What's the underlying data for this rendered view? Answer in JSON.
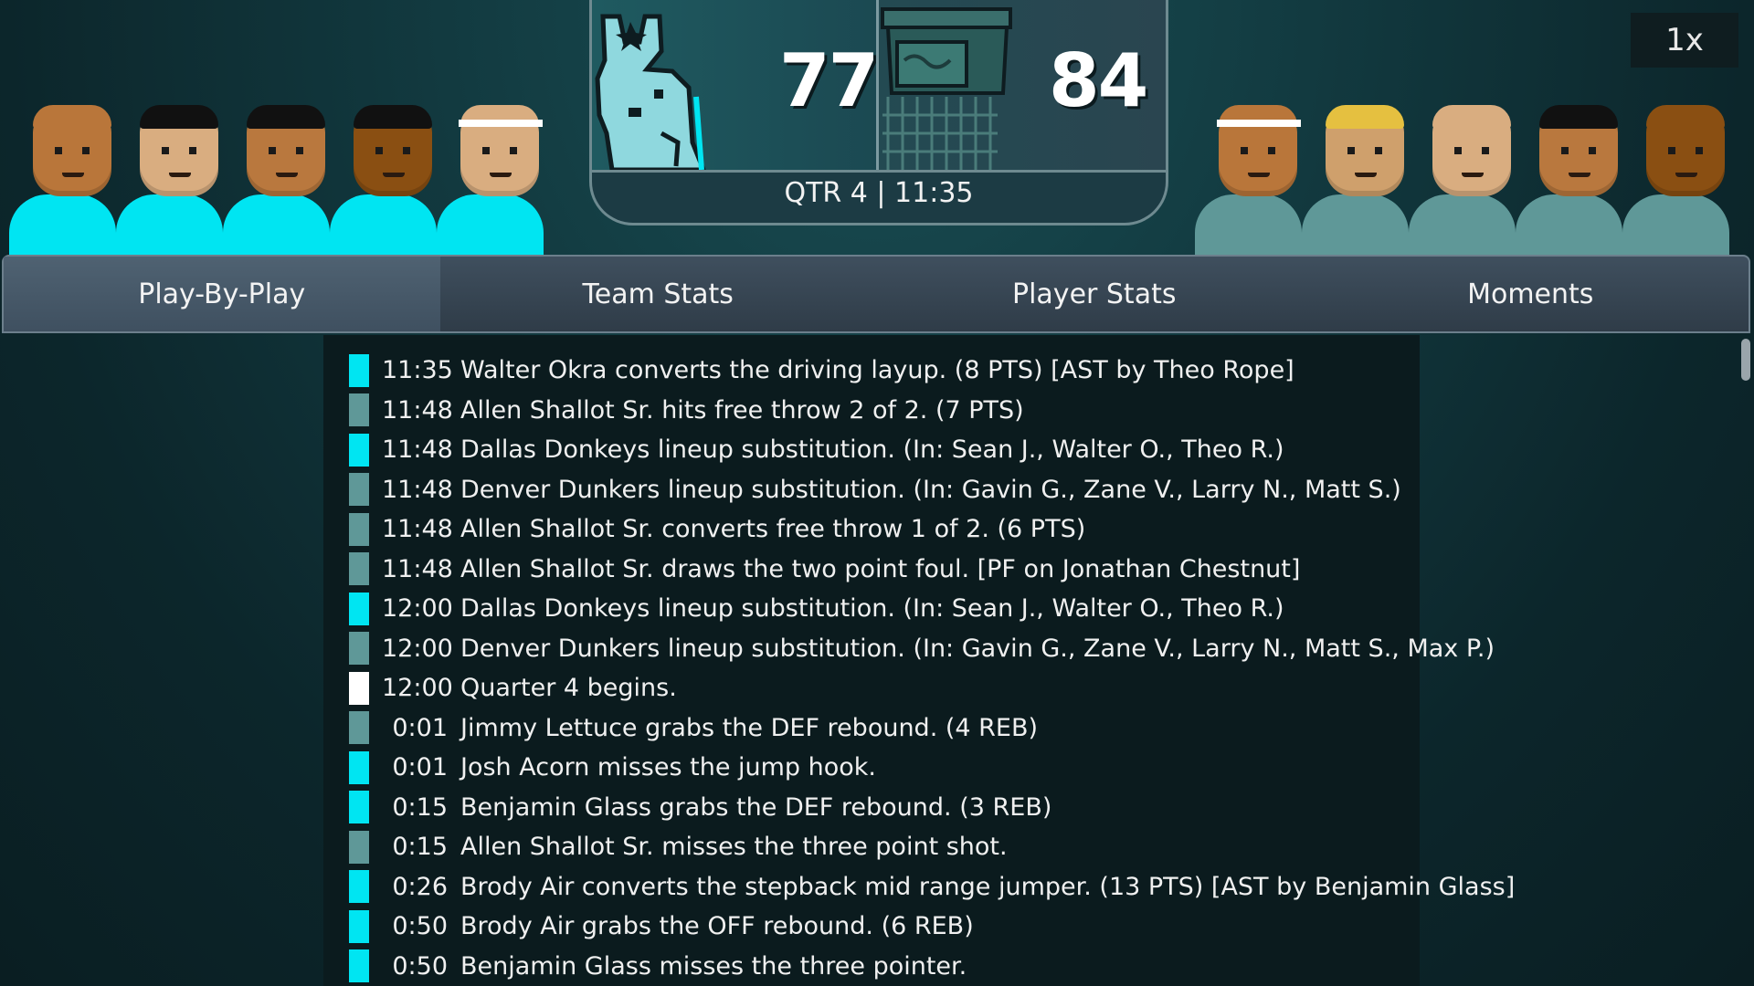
{
  "colors": {
    "home_team": "#00e5f2",
    "away_team": "#5f9898",
    "period_marker": "#ffffff",
    "background": "#0b1b1e"
  },
  "home_roster": [
    {
      "skin": "#b9763a",
      "hair": "#b9763a",
      "headband": false
    },
    {
      "skin": "#d9ad80",
      "hair": "#111111",
      "headband": false
    },
    {
      "skin": "#b9783e",
      "hair": "#111111",
      "headband": false
    },
    {
      "skin": "#8a4f12",
      "hair": "#111111",
      "headband": false
    },
    {
      "skin": "#d9ad80",
      "hair": "#d9ad80",
      "headband": true
    }
  ],
  "away_roster": [
    {
      "skin": "#b9763a",
      "hair": "#b9763a",
      "headband": true
    },
    {
      "skin": "#cfa06c",
      "hair": "#e5c040",
      "headband": false
    },
    {
      "skin": "#d9ad80",
      "hair": "#d9ad80",
      "headband": false
    },
    {
      "skin": "#b9783e",
      "hair": "#111111",
      "headband": false
    },
    {
      "skin": "#8a4f12",
      "hair": "#8a4f12",
      "headband": false
    }
  ],
  "scoreboard": {
    "home_logo_icon": "donkey-logo-icon",
    "away_logo_icon": "dunkers-logo-icon",
    "home_score": "77",
    "away_score": "84",
    "clock_text": "QTR 4  |  11:35"
  },
  "speed": {
    "label": "1x"
  },
  "tabs": [
    {
      "label": "Play-By-Play",
      "active": true
    },
    {
      "label": "Team Stats",
      "active": false
    },
    {
      "label": "Player Stats",
      "active": false
    },
    {
      "label": "Moments",
      "active": false
    }
  ],
  "plays": [
    {
      "team": "home",
      "time": "11:35",
      "text": "Walter Okra converts the driving layup. (8 PTS) [AST by Theo Rope]"
    },
    {
      "team": "away",
      "time": "11:48",
      "text": "Allen Shallot Sr. hits free throw 2 of 2. (7 PTS)"
    },
    {
      "team": "home",
      "time": "11:48",
      "text": "Dallas Donkeys lineup substitution. (In: Sean J., Walter O., Theo R.)"
    },
    {
      "team": "away",
      "time": "11:48",
      "text": "Denver Dunkers lineup substitution. (In: Gavin G., Zane V., Larry N., Matt S.)"
    },
    {
      "team": "away",
      "time": "11:48",
      "text": "Allen Shallot Sr. converts free throw 1 of 2. (6 PTS)"
    },
    {
      "team": "away",
      "time": "11:48",
      "text": "Allen Shallot Sr. draws the two point foul. [PF on Jonathan Chestnut]"
    },
    {
      "team": "home",
      "time": "12:00",
      "text": "Dallas Donkeys lineup substitution. (In: Sean J., Walter O., Theo R.)"
    },
    {
      "team": "away",
      "time": "12:00",
      "text": "Denver Dunkers lineup substitution. (In: Gavin G., Zane V., Larry N., Matt S., Max P.)"
    },
    {
      "team": "period",
      "time": "12:00",
      "text": "Quarter 4 begins."
    },
    {
      "team": "away",
      "time": "0:01",
      "text": "Jimmy Lettuce grabs the DEF rebound. (4 REB)"
    },
    {
      "team": "home",
      "time": "0:01",
      "text": "Josh Acorn misses the jump hook."
    },
    {
      "team": "home",
      "time": "0:15",
      "text": "Benjamin Glass grabs the DEF rebound. (3 REB)"
    },
    {
      "team": "away",
      "time": "0:15",
      "text": "Allen Shallot Sr. misses the three point shot."
    },
    {
      "team": "home",
      "time": "0:26",
      "text": "Brody Air converts the stepback mid range jumper. (13 PTS) [AST by Benjamin Glass]"
    },
    {
      "team": "home",
      "time": "0:50",
      "text": "Brody Air grabs the OFF rebound. (6 REB)"
    },
    {
      "team": "home",
      "time": "0:50",
      "text": "Benjamin Glass misses the three pointer."
    }
  ]
}
